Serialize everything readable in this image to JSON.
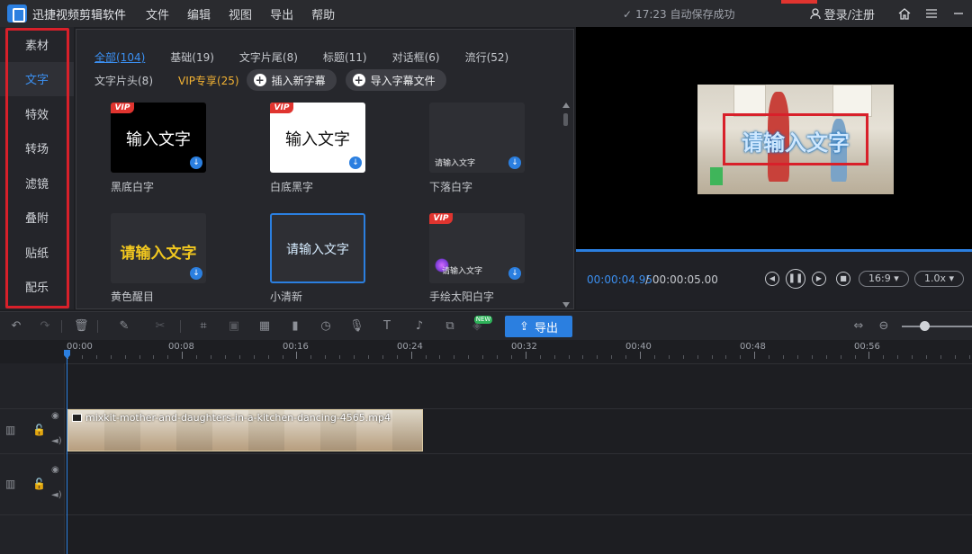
{
  "app": {
    "name": "迅捷视频剪辑软件",
    "menu": [
      "文件",
      "编辑",
      "视图",
      "导出",
      "帮助"
    ],
    "autosave": "17:23 自动保存成功",
    "login": "登录/注册"
  },
  "sidebar": {
    "items": [
      "素材",
      "文字",
      "特效",
      "转场",
      "滤镜",
      "叠附",
      "贴纸",
      "配乐"
    ],
    "active_index": 1
  },
  "panel": {
    "tabs_row1": [
      "全部(104)",
      "基础(19)",
      "文字片尾(8)",
      "标题(11)",
      "对话框(6)",
      "流行(52)"
    ],
    "tabs_row2": [
      "文字片头(8)",
      "VIP专享(25)"
    ],
    "insert_button": "插入新字幕",
    "import_button": "导入字幕文件",
    "templates": [
      {
        "label": "黑底白字",
        "card_text": "输入文字",
        "vip": true
      },
      {
        "label": "白底黑字",
        "card_text": "输入文字",
        "vip": true
      },
      {
        "label": "下落白字",
        "card_text": "请输入文字",
        "vip": false
      },
      {
        "label": "黄色醒目",
        "card_text": "请输入文字",
        "vip": false
      },
      {
        "label": "小清新",
        "card_text": "请输入文字",
        "vip": false
      },
      {
        "label": "手绘太阳白字",
        "card_text": "请输入文字",
        "vip": true
      }
    ],
    "vip_tag": "VIP"
  },
  "preview": {
    "overlay_text": "请输入文字",
    "current_time": "00:00:04.95",
    "total_time": "/ 00:00:05.00",
    "progress": 1.0,
    "ratio": "16:9",
    "speed": "1.0x"
  },
  "toolbar": {
    "export_label": "导出",
    "new_badge": "NEW",
    "zoom_level": 0.3
  },
  "timeline": {
    "ruler_labels": [
      "00:00",
      "00:08",
      "00:16",
      "00:24",
      "00:32",
      "00:40",
      "00:48",
      "00:56"
    ],
    "clip_name": "mixkit-mother-and-daughters-in-a-kitchen-dancing-4565.mp4"
  },
  "colors": {
    "accent": "#2b7fe0",
    "vip": "#f2b233",
    "highlight": "#d8202a"
  }
}
